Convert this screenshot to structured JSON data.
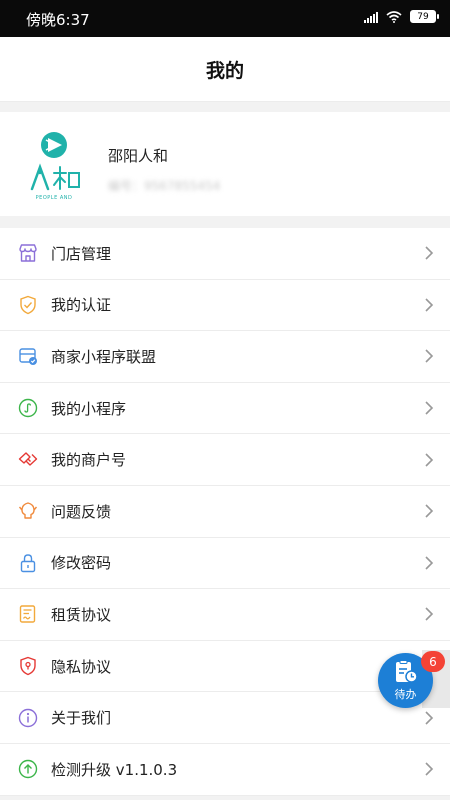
{
  "status_bar": {
    "time": "傍晚6:37",
    "battery": "79"
  },
  "header": {
    "title": "我的"
  },
  "profile": {
    "name": "邵阳人和",
    "sub_text": "编号：9567855454",
    "logo_caption": "PEOPLE AND"
  },
  "menu": [
    {
      "label": "门店管理",
      "icon": "store-icon",
      "color": "#8b6fd8"
    },
    {
      "label": "我的认证",
      "icon": "certification-shield-icon",
      "color": "#f2a93b"
    },
    {
      "label": "商家小程序联盟",
      "icon": "mini-program-alliance-icon",
      "color": "#4a90e2"
    },
    {
      "label": "我的小程序",
      "icon": "mini-program-icon",
      "color": "#3cb54a"
    },
    {
      "label": "我的商户号",
      "icon": "merchant-id-icon",
      "color": "#e53935"
    },
    {
      "label": "问题反馈",
      "icon": "feedback-icon",
      "color": "#f08a3c"
    },
    {
      "label": "修改密码",
      "icon": "lock-icon",
      "color": "#4a90e2"
    },
    {
      "label": "租赁协议",
      "icon": "lease-agreement-icon",
      "color": "#f2a93b"
    },
    {
      "label": "隐私协议",
      "icon": "privacy-shield-icon",
      "color": "#e53935"
    },
    {
      "label": "关于我们",
      "icon": "info-icon",
      "color": "#8b6fd8"
    },
    {
      "label": "检测升级 v1.1.0.3",
      "icon": "upgrade-icon",
      "color": "#3cb54a"
    }
  ],
  "floating_button": {
    "label": "待办",
    "badge": "6",
    "color": "#1d7fd6"
  }
}
